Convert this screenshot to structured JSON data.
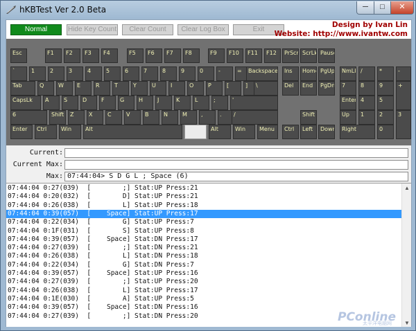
{
  "window": {
    "title": "hKBTest Ver 2.0 Beta",
    "controls": {
      "minimize": "─",
      "maximize": "□",
      "close": "✕"
    }
  },
  "toolbar": {
    "buttons": [
      {
        "label": "Normal",
        "state": "active"
      },
      {
        "label": "Hide Key Count",
        "state": "disabled"
      },
      {
        "label": "Clear Count",
        "state": "disabled"
      },
      {
        "label": "Clear Log Box",
        "state": "disabled"
      },
      {
        "label": "Exit",
        "state": "disabled"
      }
    ],
    "designer": "Design by Ivan Lin",
    "website": "Website: http://www.ivantw.com"
  },
  "keyboard": {
    "keys": [
      {
        "label": "Esc",
        "hl": false
      },
      {
        "label": "F1",
        "hl": false
      },
      {
        "label": "F2",
        "hl": false
      },
      {
        "label": "F3",
        "hl": false
      },
      {
        "label": "F4",
        "hl": false
      },
      {
        "label": "F5",
        "hl": false
      },
      {
        "label": "F6",
        "hl": false
      },
      {
        "label": "F7",
        "hl": false
      },
      {
        "label": "F8",
        "hl": false
      },
      {
        "label": "F9",
        "hl": false
      },
      {
        "label": "F10",
        "hl": false
      },
      {
        "label": "F11",
        "hl": false
      },
      {
        "label": "F12",
        "hl": false
      },
      {
        "label": "PrScr",
        "hl": false
      },
      {
        "label": "ScrLk",
        "hl": false
      },
      {
        "label": "Pause",
        "hl": false
      },
      {
        "label": "`",
        "hl": false
      },
      {
        "label": "1",
        "hl": false
      },
      {
        "label": "2",
        "hl": false
      },
      {
        "label": "3",
        "hl": false
      },
      {
        "label": "4",
        "hl": false
      },
      {
        "label": "5",
        "hl": false
      },
      {
        "label": "6",
        "hl": false
      },
      {
        "label": "7",
        "hl": false
      },
      {
        "label": "8",
        "hl": false
      },
      {
        "label": "9",
        "hl": false
      },
      {
        "label": "0",
        "hl": false
      },
      {
        "label": "-",
        "hl": false
      },
      {
        "label": "=",
        "hl": false
      },
      {
        "label": "Backspace",
        "hl": false
      },
      {
        "label": "Ins",
        "hl": false
      },
      {
        "label": "Home",
        "hl": false
      },
      {
        "label": "PgUp",
        "hl": false
      },
      {
        "label": "NmLk",
        "hl": false
      },
      {
        "label": "/",
        "hl": false
      },
      {
        "label": "*",
        "hl": false
      },
      {
        "label": "-",
        "hl": false
      },
      {
        "label": "Tab",
        "hl": false
      },
      {
        "label": "Q",
        "hl": false
      },
      {
        "label": "W",
        "hl": false
      },
      {
        "label": "E",
        "hl": false
      },
      {
        "label": "R",
        "hl": false
      },
      {
        "label": "T",
        "hl": false
      },
      {
        "label": "Y",
        "hl": false
      },
      {
        "label": "U",
        "hl": false
      },
      {
        "label": "I",
        "hl": false
      },
      {
        "label": "O",
        "hl": false
      },
      {
        "label": "P",
        "hl": false
      },
      {
        "label": "[",
        "hl": false
      },
      {
        "label": "]",
        "hl": false
      },
      {
        "label": "\\",
        "hl": false
      },
      {
        "label": "Del",
        "hl": false
      },
      {
        "label": "End",
        "hl": false
      },
      {
        "label": "PgDn",
        "hl": false
      },
      {
        "label": "7",
        "hl": false
      },
      {
        "label": "8",
        "hl": false
      },
      {
        "label": "9",
        "hl": false
      },
      {
        "label": "+",
        "hl": false
      },
      {
        "label": "CapsLk",
        "hl": false
      },
      {
        "label": "A",
        "hl": false
      },
      {
        "label": "S",
        "hl": false
      },
      {
        "label": "D",
        "hl": false
      },
      {
        "label": "F",
        "hl": false
      },
      {
        "label": "G",
        "hl": false
      },
      {
        "label": "H",
        "hl": false
      },
      {
        "label": "J",
        "hl": false
      },
      {
        "label": "K",
        "hl": false
      },
      {
        "label": "L",
        "hl": false
      },
      {
        "label": ";",
        "hl": false
      },
      {
        "label": "'",
        "hl": false
      },
      {
        "label": "Enter",
        "hl": false
      },
      {
        "label": "4",
        "hl": false
      },
      {
        "label": "5",
        "hl": false
      },
      {
        "label": "6",
        "hl": false
      },
      {
        "label": "Shift",
        "hl": false
      },
      {
        "label": "Z",
        "hl": false
      },
      {
        "label": "X",
        "hl": false
      },
      {
        "label": "C",
        "hl": false
      },
      {
        "label": "V",
        "hl": false
      },
      {
        "label": "B",
        "hl": false
      },
      {
        "label": "N",
        "hl": false
      },
      {
        "label": "M",
        "hl": false
      },
      {
        "label": ",",
        "hl": false
      },
      {
        "label": ".",
        "hl": false
      },
      {
        "label": "/",
        "hl": false
      },
      {
        "label": "Shift",
        "hl": false
      },
      {
        "label": "Up",
        "hl": false
      },
      {
        "label": "1",
        "hl": false
      },
      {
        "label": "2",
        "hl": false
      },
      {
        "label": "3",
        "hl": false
      },
      {
        "label": "Enter",
        "hl": false
      },
      {
        "label": "Ctrl",
        "hl": false
      },
      {
        "label": "Win",
        "hl": false
      },
      {
        "label": "Alt",
        "hl": false
      },
      {
        "label": "",
        "hl": true
      },
      {
        "label": "Alt",
        "hl": false
      },
      {
        "label": "Win",
        "hl": false
      },
      {
        "label": "Menu",
        "hl": false
      },
      {
        "label": "Ctrl",
        "hl": false
      },
      {
        "label": "Left",
        "hl": false
      },
      {
        "label": "Down",
        "hl": false
      },
      {
        "label": "Right",
        "hl": false
      },
      {
        "label": "0",
        "hl": false
      },
      {
        "label": ".",
        "hl": false
      }
    ]
  },
  "fields": {
    "current_label": "Current:",
    "current_value": "",
    "current_max_label": "Current Max:",
    "current_max_value": "",
    "max_label": "Max:",
    "max_value": "07:44:04> S D G L ; Space (6)"
  },
  "log": {
    "selected_index": 3,
    "rows": [
      "07:44:04 0:27(039)  [        ;] Stat:UP Press:21",
      "07:44:04 0:20(032)  [        D] Stat:UP Press:21",
      "07:44:04 0:26(038)  [        L] Stat:UP Press:18",
      "07:44:04 0:39(057)  [    Space] Stat:UP Press:17",
      "07:44:04 0:22(034)  [        G] Stat:UP Press:7",
      "07:44:04 0:1F(031)  [        S] Stat:UP Press:8",
      "07:44:04 0:39(057)  [    Space] Stat:DN Press:17",
      "07:44:04 0:27(039)  [        ;] Stat:DN Press:21",
      "07:44:04 0:26(038)  [        L] Stat:DN Press:18",
      "07:44:04 0:22(034)  [        G] Stat:DN Press:7",
      "07:44:04 0:39(057)  [    Space] Stat:UP Press:16",
      "07:44:04 0:27(039)  [        ;] Stat:UP Press:20",
      "07:44:04 0:26(038)  [        L] Stat:UP Press:17",
      "07:44:04 0:1E(030)  [        A] Stat:UP Press:5",
      "07:44:04 0:39(057)  [    Space] Stat:DN Press:16",
      "07:44:04 0:27(039)  [        ;] Stat:DN Press:20"
    ]
  },
  "watermark": {
    "brand": "PConline",
    "sub": "太平洋电脑网"
  }
}
